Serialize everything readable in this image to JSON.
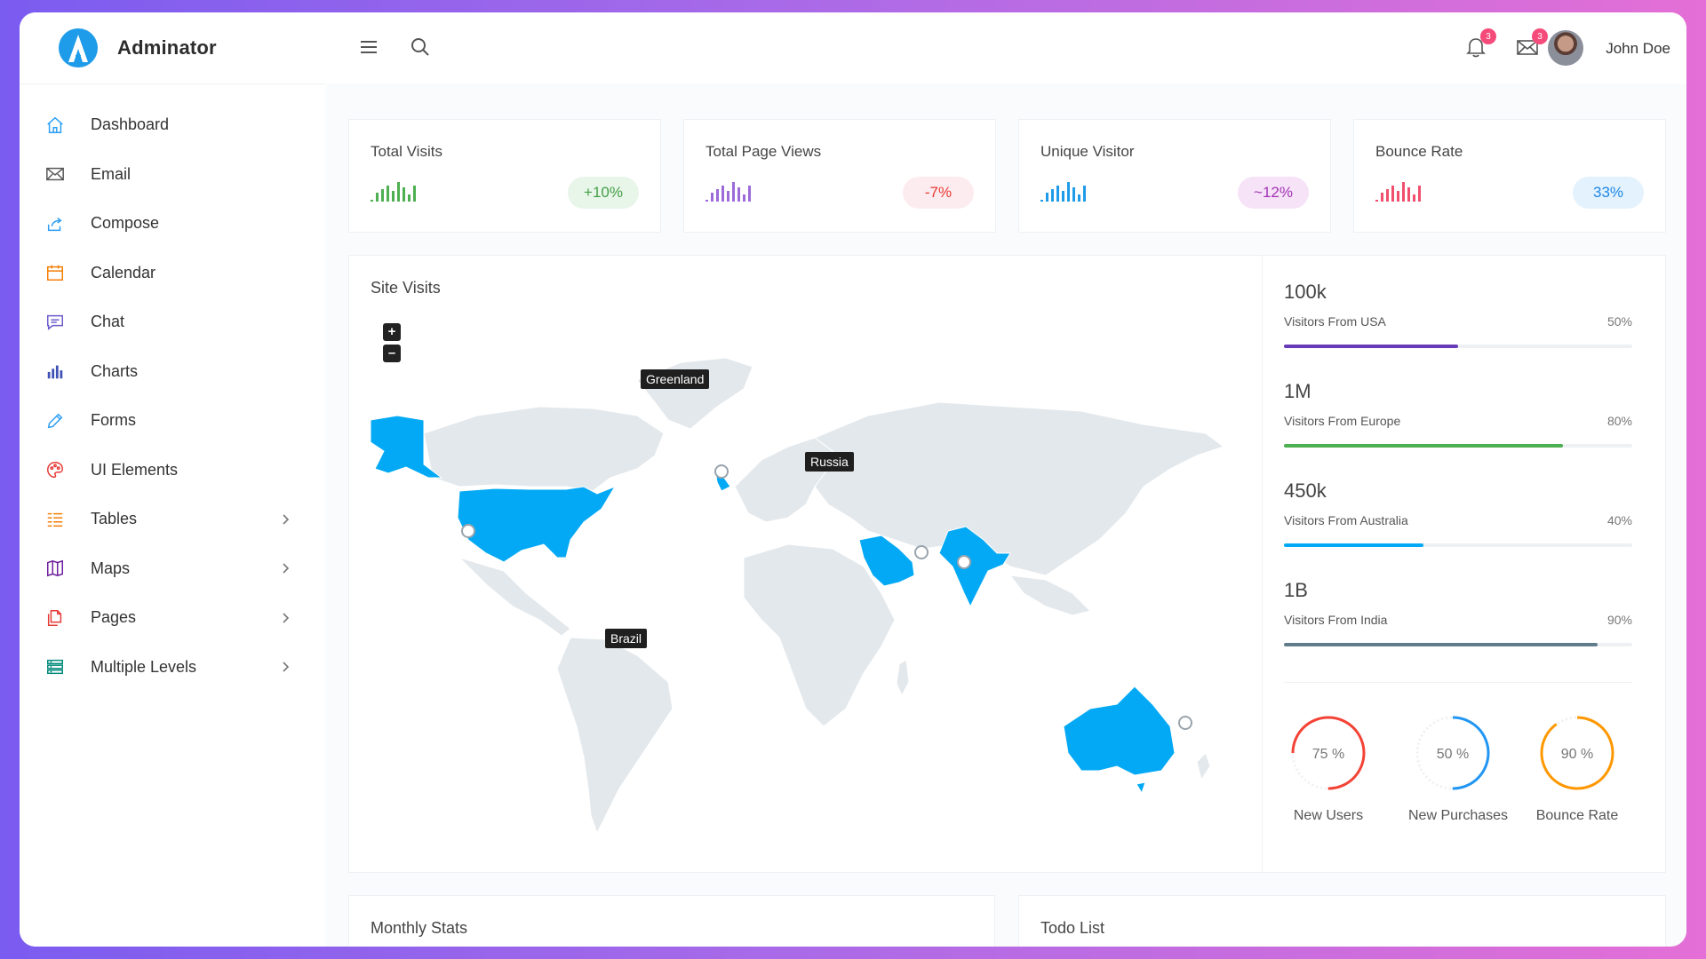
{
  "app": {
    "name": "Adminator"
  },
  "sidebar": {
    "items": [
      {
        "label": "Dashboard",
        "icon": "home-icon",
        "color": "#2a9df4"
      },
      {
        "label": "Email",
        "icon": "mail-icon",
        "color": "#555555"
      },
      {
        "label": "Compose",
        "icon": "share-icon",
        "color": "#2a9df4"
      },
      {
        "label": "Calendar",
        "icon": "calendar-icon",
        "color": "#f57c00"
      },
      {
        "label": "Chat",
        "icon": "chat-icon",
        "color": "#6a5acd"
      },
      {
        "label": "Charts",
        "icon": "bar-chart-icon",
        "color": "#3f51b5"
      },
      {
        "label": "Forms",
        "icon": "pencil-icon",
        "color": "#2a9df4"
      },
      {
        "label": "UI Elements",
        "icon": "palette-icon",
        "color": "#e53935"
      },
      {
        "label": "Tables",
        "icon": "list-icon",
        "color": "#f57c00",
        "submenu": true
      },
      {
        "label": "Maps",
        "icon": "map-icon",
        "color": "#6a1b9a",
        "submenu": true
      },
      {
        "label": "Pages",
        "icon": "files-icon",
        "color": "#e53935",
        "submenu": true
      },
      {
        "label": "Multiple Levels",
        "icon": "layers-icon",
        "color": "#00897b",
        "submenu": true
      }
    ]
  },
  "topbar": {
    "notifications_count": "3",
    "messages_count": "3",
    "user_name": "John Doe"
  },
  "stats": [
    {
      "title": "Total Visits",
      "change": "+10%",
      "color": "#4caf50",
      "pill_bg": "#e8f5e9"
    },
    {
      "title": "Total Page Views",
      "change": "-7%",
      "color": "#9c6ad9",
      "pill_bg": "#fdecef",
      "pill_color": "#e53935"
    },
    {
      "title": "Unique Visitor",
      "change": "~12%",
      "color": "#1e9be9",
      "pill_bg": "#f6e3f7",
      "pill_color": "#a335b5"
    },
    {
      "title": "Bounce Rate",
      "change": "33%",
      "color": "#f0506e",
      "pill_bg": "#e3f2fd",
      "pill_color": "#1e88e5"
    }
  ],
  "site_visits": {
    "title": "Site Visits",
    "zoom_in": "+",
    "zoom_out": "–",
    "labels": {
      "greenland": "Greenland",
      "russia": "Russia",
      "brazil": "Brazil"
    },
    "highlight_color": "#03a9f4",
    "visitors": [
      {
        "value": "100k",
        "label": "Visitors From USA",
        "percent": "50%",
        "fill": 50,
        "color": "#673ab7"
      },
      {
        "value": "1M",
        "label": "Visitors From Europe",
        "percent": "80%",
        "fill": 80,
        "color": "#4caf50"
      },
      {
        "value": "450k",
        "label": "Visitors From Australia",
        "percent": "40%",
        "fill": 40,
        "color": "#03a9f4"
      },
      {
        "value": "1B",
        "label": "Visitors From India",
        "percent": "90%",
        "fill": 90,
        "color": "#607d8b"
      }
    ],
    "donuts": [
      {
        "value": 75,
        "text": "75 %",
        "label": "New Users",
        "color": "#f44336"
      },
      {
        "value": 50,
        "text": "50 %",
        "label": "New Purchases",
        "color": "#2196f3"
      },
      {
        "value": 90,
        "text": "90 %",
        "label": "Bounce Rate",
        "color": "#ff9800"
      }
    ]
  },
  "bottom": {
    "monthly_stats": "Monthly Stats",
    "todo_list": "Todo List"
  }
}
